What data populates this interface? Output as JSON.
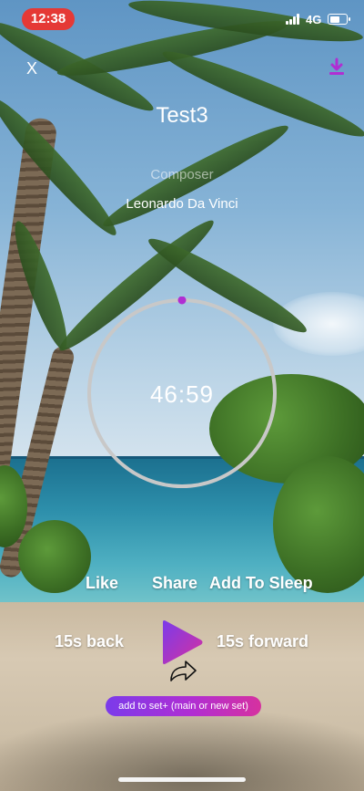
{
  "status_bar": {
    "time": "12:38",
    "network": "4G",
    "time_pill_color": "#e53935",
    "battery_level": 0.65
  },
  "header": {
    "close_label": "X",
    "download_icon": "download-icon"
  },
  "track": {
    "title": "Test3",
    "composer_label": "Composer",
    "composer_name": "Leonardo Da Vinci"
  },
  "timer": {
    "remaining": "46:59",
    "progress": 0.0
  },
  "actions": {
    "like": "Like",
    "share": "Share",
    "add_to_sleep": "Add To Sleep"
  },
  "transport": {
    "back_label": "15s back",
    "forward_label": "15s forward",
    "play_icon": "play-icon",
    "share_icon": "share-arrow-icon"
  },
  "add_set": {
    "label": "add to set+ (main or new set)"
  },
  "colors": {
    "accent_purple": "#b02ed3",
    "accent_gradient_start": "#7b3bea",
    "accent_gradient_end": "#d6319f",
    "ring": "#c8c8c8"
  }
}
